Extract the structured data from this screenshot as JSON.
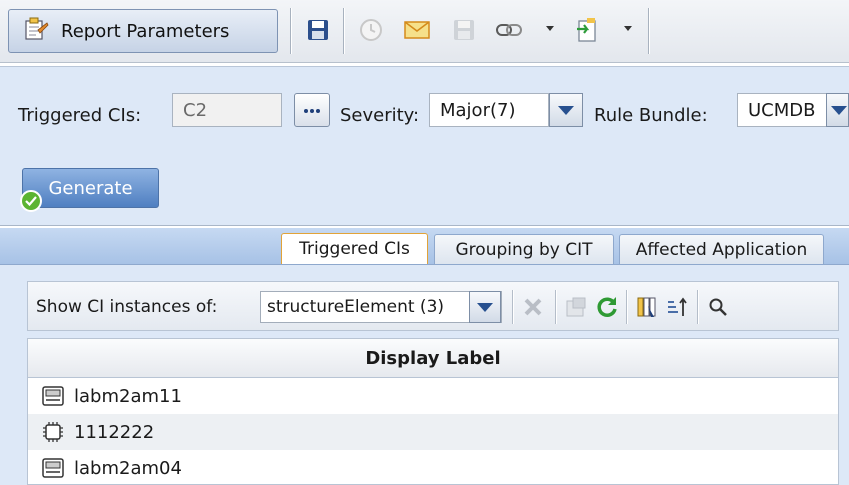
{
  "toolbar": {
    "report_params_label": "Report Parameters",
    "icons": [
      "report-params-icon",
      "save-icon",
      "schedule-icon",
      "email-icon",
      "save-disabled-icon",
      "link-icon",
      "export-icon"
    ]
  },
  "params": {
    "triggered_label": "Triggered CIs:",
    "triggered_value": "C2",
    "ellipsis_label": "...",
    "severity_label": "Severity:",
    "severity_value": "Major(7)",
    "rule_bundle_label": "Rule Bundle:",
    "rule_bundle_value": "UCMDB",
    "generate_label": "Generate"
  },
  "tabs": [
    {
      "label": "Triggered CIs",
      "active": true
    },
    {
      "label": "Grouping by CIT",
      "active": false
    },
    {
      "label": "Affected Application",
      "active": false
    }
  ],
  "results": {
    "show_label": "Show CI instances of:",
    "show_value": "structureElement (3)"
  },
  "grid": {
    "header": "Display Label",
    "rows": [
      {
        "label": "labm2am11",
        "icon": "node-icon"
      },
      {
        "label": "1112222",
        "icon": "chip-icon"
      },
      {
        "label": "labm2am04",
        "icon": "node-icon"
      }
    ]
  },
  "colors": {
    "panel": "#dde8f7",
    "tab_strip": "#a7c2e6",
    "active_tab_border": "#e2a338",
    "generate": "#4f7fc1",
    "check": "#5bb432"
  }
}
